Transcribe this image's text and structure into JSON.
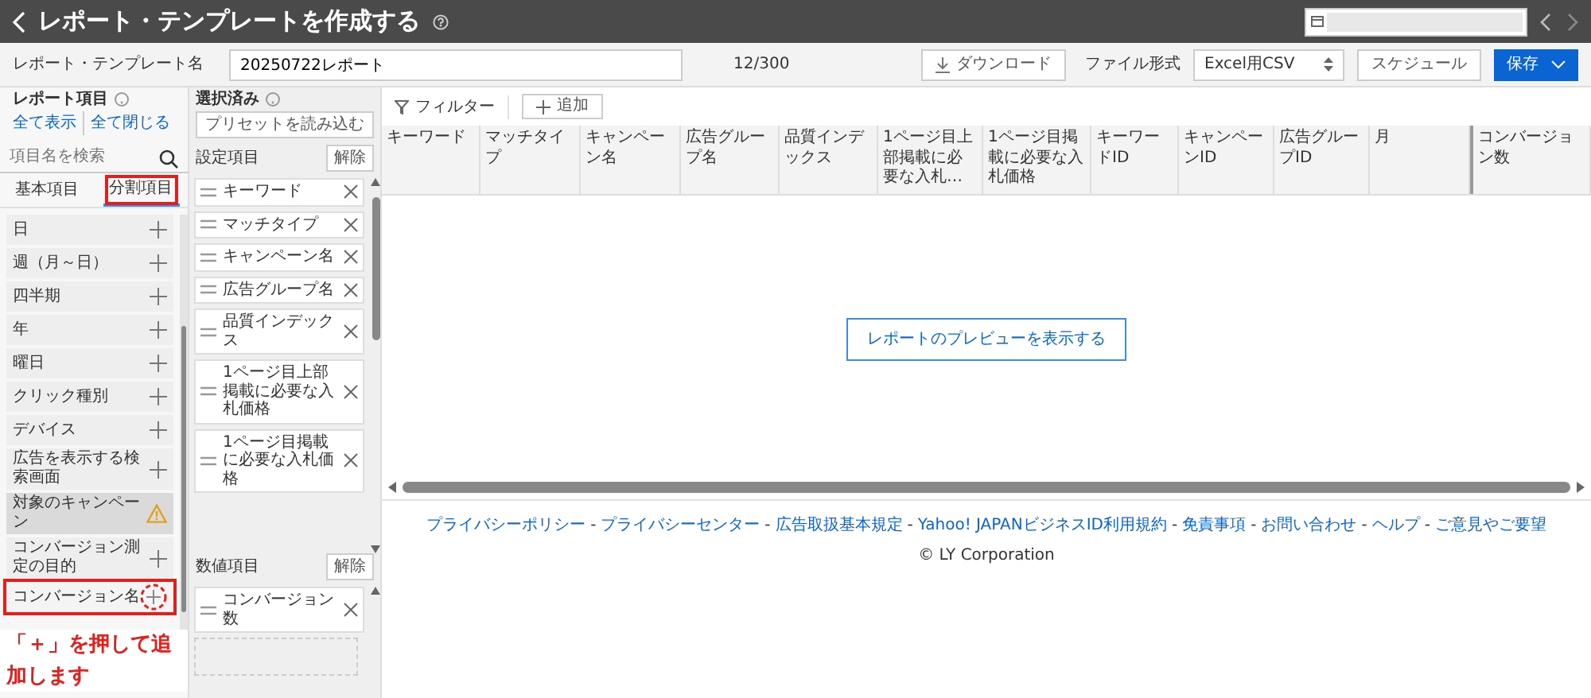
{
  "header": {
    "title": "レポート・テンプレートを作成する"
  },
  "name_row": {
    "label": "レポート・テンプレート名",
    "value": "20250722レポート",
    "count": "12/300",
    "download": "ダウンロード",
    "format_label": "ファイル形式",
    "format_value": "Excel用CSV",
    "schedule": "スケジュール",
    "save": "保存"
  },
  "report_items": {
    "title": "レポート項目",
    "show_all": "全て表示",
    "collapse_all": "全て閉じる",
    "search_placeholder": "項目名を検索",
    "tabs": [
      {
        "label": "基本項目",
        "selected": false,
        "annotated": false
      },
      {
        "label": "分割項目",
        "selected": true,
        "annotated": true
      }
    ],
    "items": [
      {
        "label": "日",
        "kind": "add",
        "annotated": false
      },
      {
        "label": "週（月～日）",
        "kind": "add",
        "annotated": false
      },
      {
        "label": "四半期",
        "kind": "add",
        "annotated": false
      },
      {
        "label": "年",
        "kind": "add",
        "annotated": false
      },
      {
        "label": "曜日",
        "kind": "add",
        "annotated": false
      },
      {
        "label": "クリック種別",
        "kind": "add",
        "annotated": false
      },
      {
        "label": "デバイス",
        "kind": "add",
        "annotated": false
      },
      {
        "label": "広告を表示する検索画面",
        "kind": "add",
        "annotated": false
      },
      {
        "label": "対象のキャンペーン",
        "kind": "warning",
        "annotated": false
      },
      {
        "label": "コンバージョン測定の目的",
        "kind": "add",
        "annotated": false
      },
      {
        "label": "コンバージョン名",
        "kind": "add",
        "annotated": true
      }
    ]
  },
  "annotation": {
    "text": "「＋」を押して追加します"
  },
  "selected": {
    "title": "選択済み",
    "preset_button": "プリセットを読み込む",
    "groups": [
      {
        "title": "設定項目",
        "clear": "解除",
        "items": [
          "キーワード",
          "マッチタイプ",
          "キャンペーン名",
          "広告グループ名",
          "品質インデックス",
          "1ページ目上部掲載に必要な入札価格",
          "1ページ目掲載に必要な入札価格"
        ]
      },
      {
        "title": "数値項目",
        "clear": "解除",
        "items": [
          "コンバージョン数"
        ]
      }
    ]
  },
  "preview": {
    "filter": "フィルター",
    "add": "追加",
    "columns": [
      "キーワード",
      "マッチタイプ",
      "キャンペーン名",
      "広告グループ名",
      "品質インデックス",
      "1ページ目上部掲載に必要な入札…",
      "1ページ目掲載に必要な入札価格",
      "キーワードID",
      "キャンペーンID",
      "広告グループID",
      "月",
      "コンバージョン数"
    ],
    "preview_button": "レポートのプレビューを表示する"
  },
  "footer": {
    "separator": "-",
    "links": [
      "プライバシーポリシー",
      "プライバシーセンター",
      "広告取扱基本規定",
      "Yahoo! JAPANビジネスID利用規約",
      "免責事項",
      "お問い合わせ",
      "ヘルプ",
      "ご意見やご要望"
    ],
    "copyright": "© LY Corporation"
  }
}
